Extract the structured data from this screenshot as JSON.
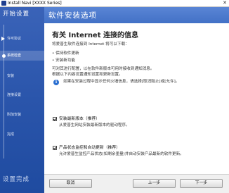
{
  "window": {
    "title": "Install Navi [XXXX Series]",
    "close_glyph": "✕"
  },
  "sidebar": {
    "header": "开始设置",
    "footer": "设置完成",
    "steps": [
      {
        "label": "许可协议",
        "state": "done"
      },
      {
        "label": "系统检查",
        "state": "active"
      },
      {
        "label": "安装",
        "state": "pending"
      },
      {
        "label": "连接设置",
        "state": "pending"
      },
      {
        "label": "附加安装",
        "state": "pending"
      },
      {
        "label": "完成",
        "state": "pending"
      }
    ]
  },
  "page": {
    "header": "软件安装选项",
    "heading": "有关 Internet 连接的信息",
    "intro": "将爱普生软件连接到 Internet 将可以下载：",
    "bullets": [
      "• 保持软件更新",
      "• 安装新功能"
    ],
    "para1": "可对其进行配置，以在软件新版本可用时接收到通知消息。",
    "para2": "根据以下内容设置通知设置和更新设置。",
    "info_icon": "i",
    "info_text": "如果在安装过程中显示任何火墙信息，请选择[取消阻止]或[允许]。",
    "options": [
      {
        "label": "安装最新版本（推荐）",
        "desc": "从爱普生网站安装最新版本的驱动程序。",
        "checked": true
      },
      {
        "label": "产品状态监控和自动更新（推荐）",
        "desc": "允许爱普生监控产品状态(如剩余墨量)并自动安装产品最新的软件更新。",
        "checked": true
      }
    ]
  },
  "buttons": {
    "cancel": "取消",
    "back": "上一步",
    "next": "下一步"
  },
  "colors": {
    "sidebar_bg": "#2a55ab",
    "header_bg": "#4a78ca",
    "info_icon": "#2a6fd0"
  }
}
